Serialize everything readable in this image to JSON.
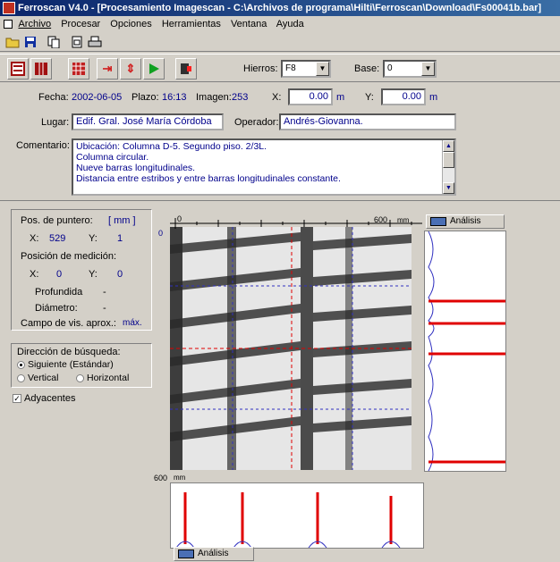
{
  "window": {
    "title": "Ferroscan V4.0 - [Procesamiento Imagescan - C:\\Archivos de programa\\Hilti\\Ferroscan\\Download\\Fs00041b.bar]"
  },
  "menu": [
    "Archivo",
    "Procesar",
    "Opciones",
    "Herramientas",
    "Ventana",
    "Ayuda"
  ],
  "toolbar": {
    "icons": [
      "open-folder-icon",
      "save-icon",
      "copy-icon",
      "page-setup-icon",
      "print-icon"
    ]
  },
  "toolbar2": {
    "hierros_label": "Hierros:",
    "hierros_value": "F8",
    "base_label": "Base:",
    "base_value": "0"
  },
  "info": {
    "fecha_label": "Fecha:",
    "fecha_value": "2002-06-05",
    "plazo_label": "Plazo:",
    "plazo_value": "16:13",
    "imagen_label": "Imagen:",
    "imagen_value": "253",
    "x_label": "X:",
    "x_value": "0.00",
    "x_unit": "m",
    "y_label": "Y:",
    "y_value": "0.00",
    "y_unit": "m",
    "lugar_label": "Lugar:",
    "lugar_value": "Edif. Gral. José María Córdoba",
    "operador_label": "Operador:",
    "operador_value": "Andrés-Giovanna.",
    "comentario_label": "Comentario:",
    "comentario_lines": [
      "Ubicación: Columna D-5. Segundo piso. 2/3L.",
      "Columna circular.",
      "Nueve barras longitudinales.",
      "Distancia entre estribos y entre barras longitudinales constante."
    ]
  },
  "pointer": {
    "pos_label": "Pos. de puntero:",
    "unit": "[ mm ]",
    "x_label": "X:",
    "x_value": "529",
    "y_label": "Y:",
    "y_value": "1",
    "medicion_label": "Posición de medición:",
    "mx_label": "X:",
    "mx_value": "0",
    "my_label": "Y:",
    "my_value": "0",
    "profundidad_label": "Profundida",
    "profundidad_value": "-",
    "diametro_label": "Diámetro:",
    "diametro_value": "-",
    "campo_label": "Campo de vis. aprox.:",
    "campo_value": "máx."
  },
  "direccion": {
    "title": "Dirección de búsqueda:",
    "siguiente": "Siguiente (Estándar)",
    "vertical": "Vertical",
    "horizontal": "Horizontal",
    "selected": "Siguiente (Estándar)"
  },
  "adyacentes": {
    "label": "Adyacentes",
    "checked": true
  },
  "scan": {
    "top_left_label": "0",
    "top_right_label": "600",
    "top_unit": "mm",
    "left_top_label": "0",
    "bottom_left_label": "600",
    "bottom_unit": "mm"
  },
  "analysis": {
    "right_tab": "Análisis",
    "bottom_tab": "Análisis"
  },
  "colors": {
    "title_start": "#0a246a",
    "title_end": "#3a6ea5",
    "value_text": "#00008b",
    "marker_red": "#e00000",
    "grid_blue": "#3030c0"
  }
}
